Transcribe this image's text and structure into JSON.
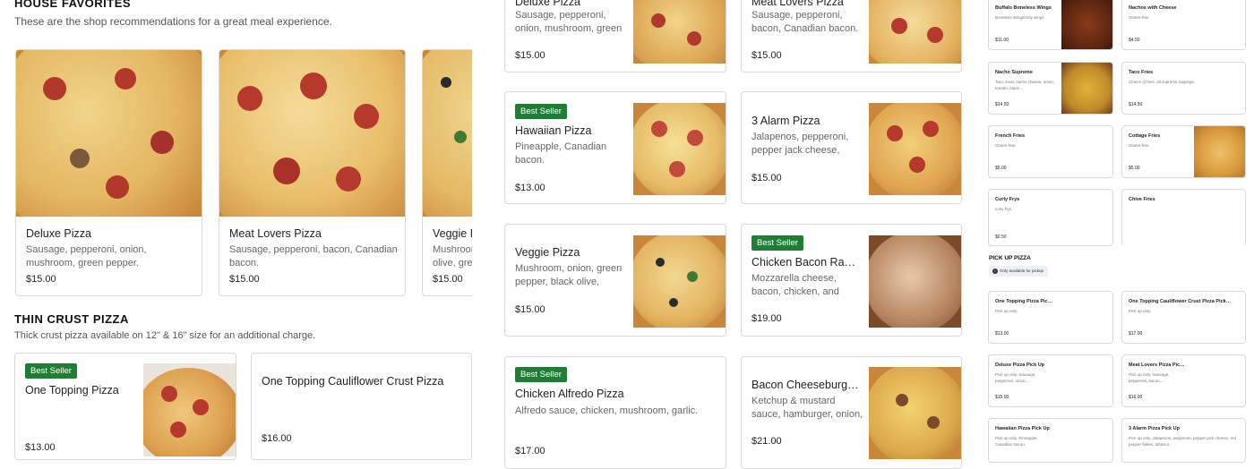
{
  "colors": {
    "best_seller_bg": "#1e7e34",
    "border": "#d9d9d9",
    "text": "#222222",
    "muted": "#666666"
  },
  "house": {
    "title": "HOUSE FAVORITES",
    "subtitle": "These are the shop recommendations for a great meal experience.",
    "cards": [
      {
        "name": "Deluxe Pizza",
        "desc": "Sausage, pepperoni, onion, mushroom, green pepper.",
        "price": "$15.00"
      },
      {
        "name": "Meat Lovers Pizza",
        "desc": "Sausage, pepperoni, bacon, Canadian bacon.",
        "price": "$15.00"
      },
      {
        "name": "Veggie Pizza",
        "desc": "Mushroom, onion, green pepper, black olive, green",
        "price": "$15.00"
      }
    ]
  },
  "thin": {
    "title": "THIN CRUST PIZZA",
    "subtitle": "Thick crust pizza available on 12\" & 16\" size for an additional charge.",
    "cards": [
      {
        "badge": "Best Seller",
        "name": "One Topping Pizza",
        "price": "$13.00"
      },
      {
        "name": "One Topping Cauliflower Crust Pizza",
        "price": "$16.00"
      }
    ]
  },
  "mid": {
    "cards": [
      {
        "name": "Deluxe Pizza",
        "desc": "Sausage, pepperoni, onion, mushroom, green pepper.",
        "price": "$15.00"
      },
      {
        "name": "Meat Lovers Pizza",
        "desc": "Sausage, pepperoni, bacon, Canadian bacon.",
        "price": "$15.00"
      },
      {
        "badge": "Best Seller",
        "name": "Hawaiian Pizza",
        "desc": "Pineapple, Canadian bacon.",
        "price": "$13.00"
      },
      {
        "name": "3 Alarm Pizza",
        "desc": "Jalapenos, pepperoni, pepper jack cheese, red…",
        "price": "$15.00"
      },
      {
        "name": "Veggie Pizza",
        "desc": "Mushroom, onion, green pepper, black olive, green…",
        "price": "$15.00"
      },
      {
        "badge": "Best Seller",
        "name": "Chicken Bacon Ranch Pizza",
        "desc": "Mozzarella cheese, bacon, chicken, and yummy ran…",
        "price": "$19.00"
      },
      {
        "badge": "Best Seller",
        "name": "Chicken Alfredo Pizza",
        "desc": "Alfredo sauce, chicken, mushroom, garlic.",
        "price": "$17.00"
      },
      {
        "name": "Bacon Cheeseburger Pizza",
        "desc": "Ketchup & mustard sauce, hamburger, onion, bacon.",
        "price": "$21.00"
      }
    ]
  },
  "right": {
    "items": [
      {
        "name": "Buffalo Boneless Wings",
        "desc": "Boneless Wings/only wings",
        "price": "$11.00"
      },
      {
        "name": "Nachos with Cheese",
        "desc": "Gluten-free.",
        "price": "$4.50"
      },
      {
        "name": "Nacho Supreme",
        "desc": "Taco meat, nacho cheese, onion, tomato, black…",
        "price": "$14.50"
      },
      {
        "name": "Taco Fries",
        "desc": "Choice of fries, all supreme toppings.",
        "price": "$14.50"
      },
      {
        "name": "French Fries",
        "desc": "Gluten-free.",
        "price": "$5.00"
      },
      {
        "name": "Cottage Fries",
        "desc": "Gluten-free.",
        "price": "$5.00"
      },
      {
        "name": "Curly Frys",
        "desc": "curly frys",
        "price": "$0.50"
      },
      {
        "name": "Chive Fries",
        "desc": "",
        "price": ""
      }
    ],
    "pickup_title": "PICK UP PIZZA",
    "pickup_note": "Only available for pickup",
    "pickup_items": [
      {
        "name": "One Topping Pizza Pic…",
        "desc": "Pick up only.",
        "price": "$13.00"
      },
      {
        "name": "One Topping Cauliflower Crust Pizza Pick…",
        "desc": "Pick up only.",
        "price": "$17.00"
      },
      {
        "name": "Deluxe Pizza Pick Up",
        "desc": "Pick up only. Sausage, pepperoni, onion,…",
        "price": "$15.00"
      },
      {
        "name": "Meat Lovers Pizza Pic…",
        "desc": "Pick up only. Sausage, pepperoni, bacon,…",
        "price": "$16.00"
      },
      {
        "name": "Hawaiian Pizza Pick Up",
        "desc": "Pick up only. Pineapple, Canadian bacon.",
        "price": ""
      },
      {
        "name": "3 Alarm Pizza Pick Up",
        "desc": "Pick up only. Jalapenos, pepperoni, pepper jack cheese, red pepper flakes, tabasco.",
        "price": ""
      }
    ]
  }
}
